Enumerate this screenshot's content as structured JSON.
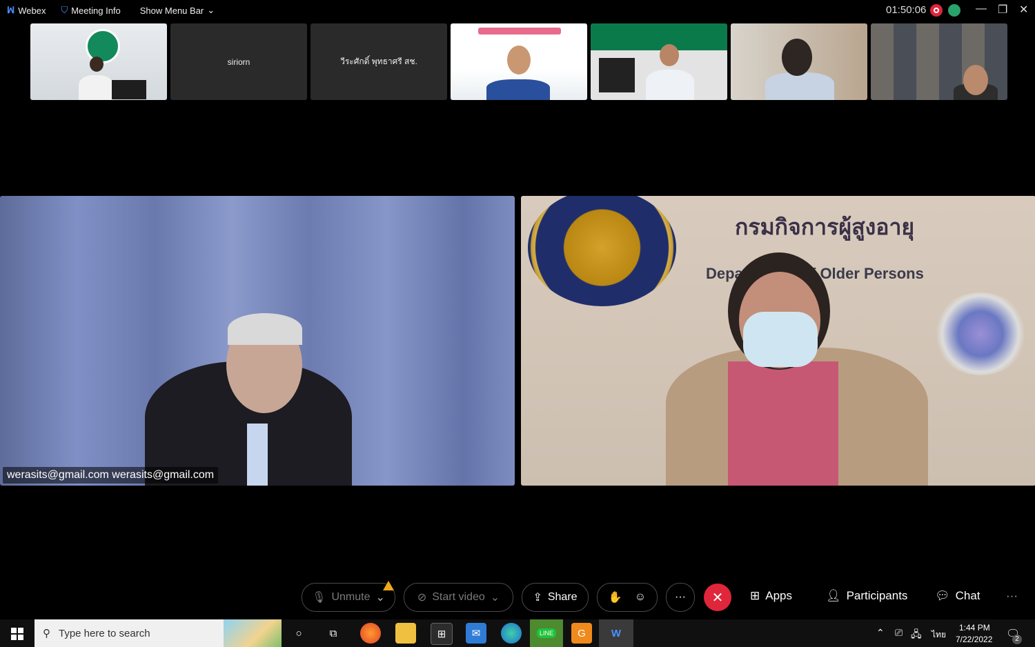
{
  "topbar": {
    "app_name": "Webex",
    "meeting_info": "Meeting Info",
    "show_menu_bar": "Show Menu Bar",
    "timer": "01:50:06"
  },
  "thumbnails": [
    {
      "label": ""
    },
    {
      "label": "siriorn"
    },
    {
      "label": "วีระศักดิ์ พุทธาศรี สช."
    },
    {
      "label": ""
    },
    {
      "label": ""
    },
    {
      "label": ""
    },
    {
      "label": ""
    }
  ],
  "main_tiles": {
    "left_name": "werasits@gmail.com werasits@gmail.com",
    "right_title": "กรมกิจการผู้สูงอายุ",
    "right_sub_left": "Depa",
    "right_sub_right": "f Older Persons"
  },
  "controls": {
    "unmute": "Unmute",
    "start_video": "Start video",
    "share": "Share",
    "more": "···",
    "apps": "Apps",
    "participants": "Participants",
    "chat": "Chat",
    "overflow": "···"
  },
  "taskbar": {
    "search_placeholder": "Type here to search",
    "time": "1:44 PM",
    "date": "7/22/2022",
    "lang": "ไทย",
    "notifications": "2"
  },
  "colors": {
    "end_call": "#e0263b",
    "record": "#e0263b",
    "network": "#29a36a",
    "warning": "#f0a81c"
  }
}
